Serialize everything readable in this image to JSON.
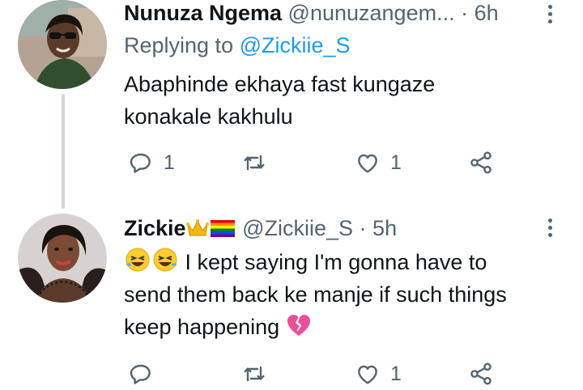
{
  "tweets": [
    {
      "name": "Nunuza Ngema",
      "handle": "@nunuzangem...",
      "separator": "·",
      "time": "6h",
      "replying_prefix": "Replying to",
      "replying_to": "@Zickiie_S",
      "text_line1": "Abaphinde ekhaya fast kungaze",
      "text_line2": "konakale kakhulu",
      "replies": "1",
      "retweets": "",
      "likes": "1"
    },
    {
      "name": "Zickie",
      "handle": "@Zickiie_S",
      "separator": "·",
      "time": "5h",
      "text_line1": "I kept saying I'm gonna have to",
      "text_line2": "send them back ke manje if such things",
      "text_line3": "keep happening",
      "replies": "",
      "retweets": "",
      "likes": "1"
    }
  ],
  "colors": {
    "secondary_text": "#536471",
    "primary_text": "#0f1419",
    "link": "#1d9bf0",
    "thread_line": "#cfd9de"
  },
  "icons": [
    "reply-icon",
    "retweet-icon",
    "like-icon",
    "share-icon",
    "more-icon",
    "laughing-emoji-icon",
    "crown-emoji-icon",
    "rainbow-flag-emoji-icon",
    "broken-heart-emoji-icon"
  ]
}
